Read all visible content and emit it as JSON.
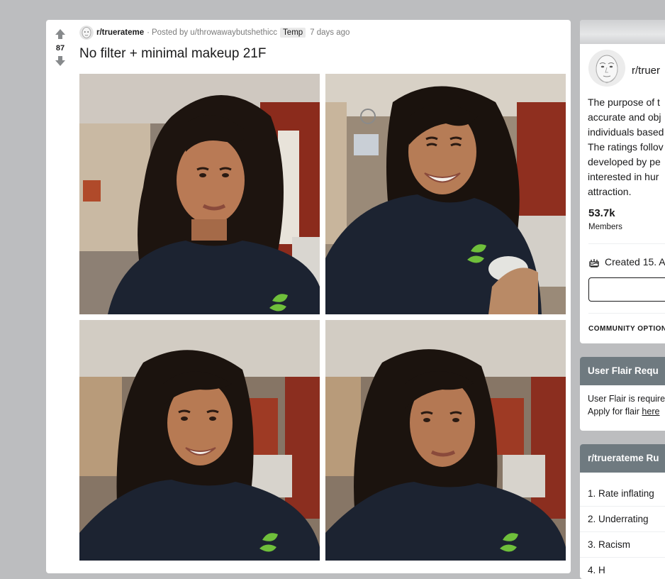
{
  "post": {
    "score": "87",
    "subreddit": "r/truerateme",
    "separator": "·",
    "posted_by": "Posted by u/throwawaybutshethicc",
    "flair": "Temp",
    "time": "7 days ago",
    "title": "No filter + minimal makeup 21F",
    "images": [
      {
        "alt": "selfie-1"
      },
      {
        "alt": "selfie-2"
      },
      {
        "alt": "selfie-3"
      },
      {
        "alt": "selfie-4"
      }
    ]
  },
  "sidebar": {
    "about": {
      "community_name": "r/truer",
      "description_lines": [
        "The purpose of t",
        "accurate and obj",
        "individuals based",
        "The ratings follov",
        "developed by pe",
        "interested in hur",
        "attraction."
      ],
      "members_count": "53.7k",
      "members_label": "Members",
      "created": "Created 15. A",
      "join_label": "",
      "community_options": "COMMUNITY OPTION"
    },
    "flair": {
      "header": "User Flair Requ",
      "line1": "User Flair is require",
      "line2_prefix": "Apply for flair ",
      "link": "here"
    },
    "rules": {
      "header": "r/truerateme Ru",
      "items": [
        "1. Rate inflating",
        "2. Underrating",
        "3. Racism",
        "4. H"
      ]
    }
  },
  "colors": {
    "background": "#bcbdbf",
    "card": "#ffffff",
    "card_header": "#6f7a80",
    "text": "#1a1a1b",
    "meta_text": "#7c7c7c",
    "vote_arrow": "#878a8c"
  },
  "icons": {
    "upvote": "arrow-up-icon",
    "downvote": "arrow-down-icon",
    "cake": "cake-icon"
  }
}
